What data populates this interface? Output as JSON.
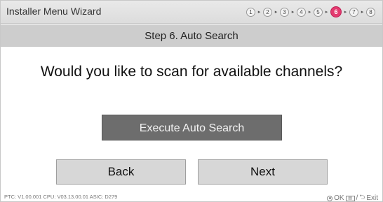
{
  "window": {
    "title": "Installer Menu Wizard"
  },
  "progress": {
    "steps": [
      "1",
      "2",
      "3",
      "4",
      "5",
      "6",
      "7",
      "8"
    ],
    "current": "6",
    "separator": "▸"
  },
  "step_header": {
    "title": "Step 6. Auto Search"
  },
  "main": {
    "question": "Would you like to scan for available channels?",
    "execute_label": "Execute Auto Search"
  },
  "nav": {
    "back_label": "Back",
    "next_label": "Next"
  },
  "footer": {
    "version": "PTC: V1.00.001 CPU: V03.13.00.01 ASIC: D279",
    "ok_label": "OK",
    "menu_icon_text": "▤",
    "slash": "/",
    "exit_label": "Exit"
  },
  "colors": {
    "active_step": "#e33a6f",
    "execute_button": "#6d6d6d",
    "nav_button": "#d7d7d7",
    "step_bar": "#cdcdcd"
  }
}
